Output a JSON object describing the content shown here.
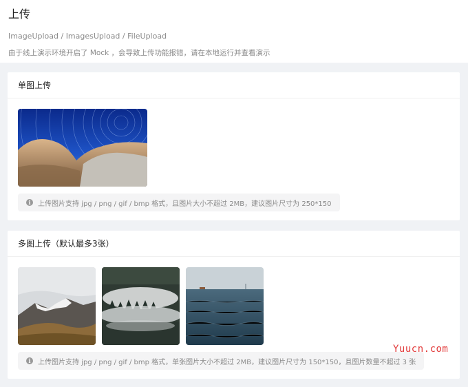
{
  "header": {
    "title": "上传",
    "subtitle": "ImageUpload / ImagesUpload / FileUpload",
    "note": "由于线上演示环境开启了 Mock ，会导致上传功能报错，请在本地运行并查看演示"
  },
  "single": {
    "title": "单图上传",
    "tip": "上传图片支持 jpg / png / gif / bmp 格式，且图片大小不超过 2MB，建议图片尺寸为 250*150"
  },
  "multi": {
    "title": "多图上传（默认最多3张）",
    "tip": "上传图片支持 jpg / png / gif / bmp 格式，单张图片大小不超过 2MB，建议图片尺寸为 150*150，且图片数量不超过 3 张"
  },
  "watermark": "Yuucn.com",
  "icons": {
    "info": "info-circle-icon"
  },
  "colors": {
    "tip_background": "#f4f4f5",
    "watermark": "#e23b3b"
  }
}
